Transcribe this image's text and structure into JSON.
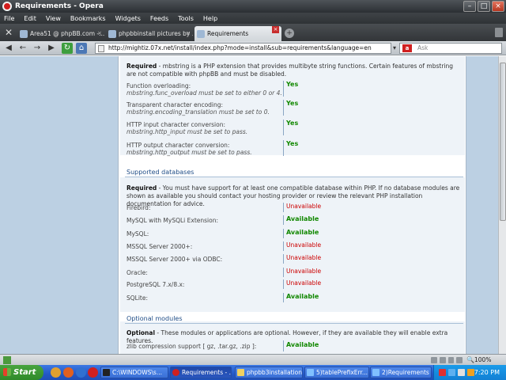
{
  "window": {
    "title": "Requirements - Opera"
  },
  "menu": [
    "File",
    "Edit",
    "View",
    "Bookmarks",
    "Widgets",
    "Feeds",
    "Tools",
    "Help"
  ],
  "tabs": [
    {
      "label": "Area51 @ phpBB.com -..."
    },
    {
      "label": "phpbbinstall pictures by ..."
    },
    {
      "label": "Requirements"
    }
  ],
  "address": {
    "url": "http://mightiz.07x.net/install/index.php?mode=install&sub=requirements&language=en",
    "search_placeholder": "Ask"
  },
  "page": {
    "mbstring_desc_bold": "Required",
    "mbstring_desc": " - mbstring is a PHP extension that provides multibyte string functions. Certain features of mbstring are not compatible with phpBB and must be disabled.",
    "mbstring_items": [
      {
        "label": "Function overloading:",
        "sub": "mbstring.func_overload must be set to either 0 or 4.",
        "status": "Yes"
      },
      {
        "label": "Transparent character encoding:",
        "sub": "mbstring.encoding_translation must be set to 0.",
        "status": "Yes"
      },
      {
        "label": "HTTP input character conversion:",
        "sub": "mbstring.http_input must be set to pass.",
        "status": "Yes"
      },
      {
        "label": "HTTP output character conversion:",
        "sub": "mbstring.http_output must be set to pass.",
        "status": "Yes"
      }
    ],
    "databases_title": "Supported databases",
    "databases_desc_bold": "Required",
    "databases_desc": " - You must have support for at least one compatible database within PHP. If no database modules are shown as available you should contact your hosting provider or review the relevant PHP installation documentation for advice.",
    "databases": [
      {
        "label": "Firebird:",
        "status": "Unavailable"
      },
      {
        "label": "MySQL with MySQLi Extension:",
        "status": "Available"
      },
      {
        "label": "MySQL:",
        "status": "Available"
      },
      {
        "label": "MSSQL Server 2000+:",
        "status": "Unavailable"
      },
      {
        "label": "MSSQL Server 2000+ via ODBC:",
        "status": "Unavailable"
      },
      {
        "label": "Oracle:",
        "status": "Unavailable"
      },
      {
        "label": "PostgreSQL 7.x/8.x:",
        "status": "Unavailable"
      },
      {
        "label": "SQLite:",
        "status": "Available"
      }
    ],
    "optional_title": "Optional modules",
    "optional_desc_bold": "Optional",
    "optional_desc": " - These modules or applications are optional. However, if they are available they will enable extra features.",
    "optional_items": [
      {
        "label": "zlib compression support [ gz, .tar.gz, .zip ]:",
        "status": "Available"
      }
    ]
  },
  "statusbar": {
    "zoom": "100%"
  },
  "taskbar": {
    "start_label": "Start",
    "tasks": [
      {
        "label": "C:\\WINDOWS\\s..."
      },
      {
        "label": "Requirements - ..."
      },
      {
        "label": "phpbb3installation"
      },
      {
        "label": "5)tablePrefixErr..."
      },
      {
        "label": "2)Requirements ..."
      }
    ],
    "clock": "7:20 PM"
  }
}
